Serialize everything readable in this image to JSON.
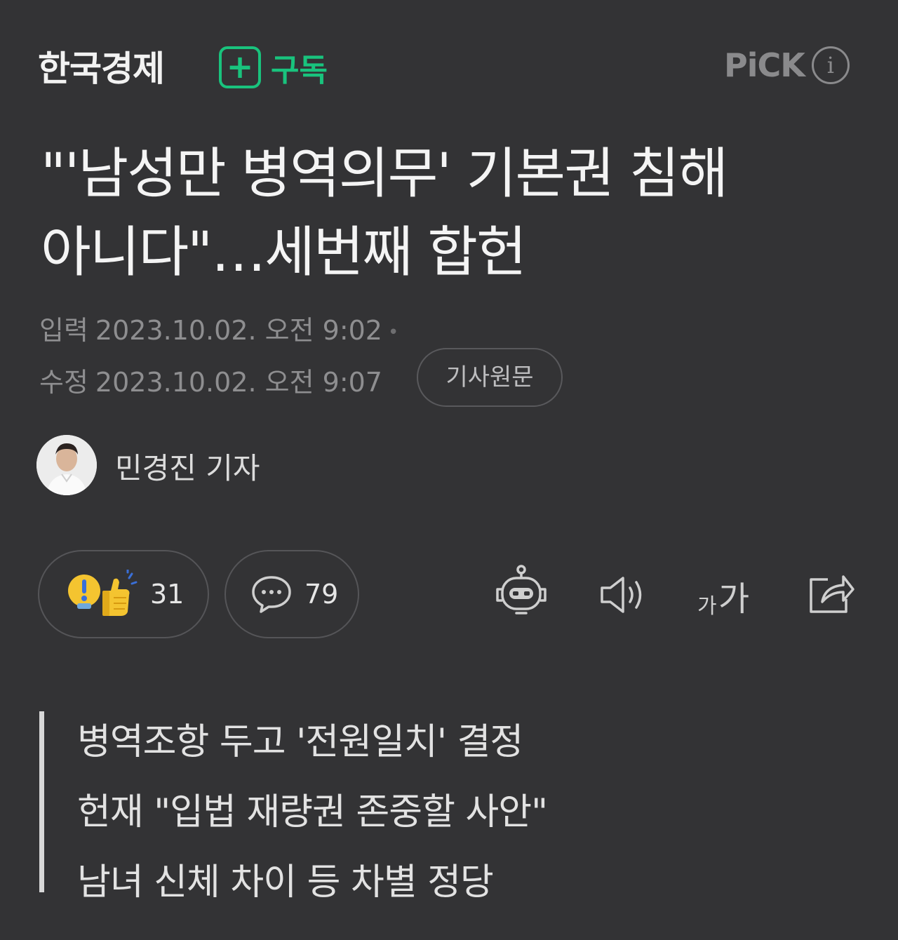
{
  "header": {
    "publisher": "한국경제",
    "subscribe_label": "구독",
    "pick_label": "PiCK",
    "info_icon": "i"
  },
  "headline": {
    "line1": "\"'남성만 병역의무' 기본권 침해",
    "line2": "아니다\"…세번째 합헌"
  },
  "meta": {
    "published_label": "입력",
    "published": "2023.10.02. 오전 9:02",
    "modified_label": "수정",
    "modified": "2023.10.02. 오전 9:07",
    "original_button": "기사원문"
  },
  "author": {
    "name": "민경진 기자"
  },
  "actions": {
    "reactions_count": "31",
    "comments_count": "79",
    "icons": [
      "summary-bot-icon",
      "speaker-icon",
      "font-size-icon",
      "share-icon"
    ]
  },
  "summary": {
    "lines": [
      "병역조항 두고 '전원일치' 결정",
      "헌재 \"입법 재량권 존중할 사안\"",
      "남녀 신체 차이 등 차별 정당"
    ]
  },
  "colors": {
    "background": "#333335",
    "accent_green": "#19c37d",
    "muted": "#8e8e90"
  }
}
